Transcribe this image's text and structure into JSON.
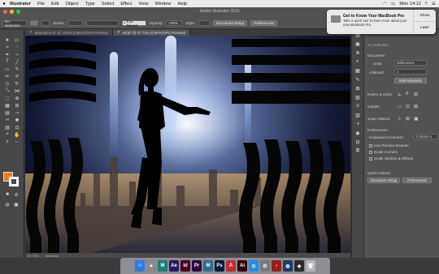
{
  "menubar": {
    "apple": "",
    "app_name": "Illustrator",
    "items": [
      "File",
      "Edit",
      "Object",
      "Type",
      "Select",
      "Effect",
      "View",
      "Window",
      "Help"
    ],
    "clock": "Mon 14:12"
  },
  "window": {
    "title": "Adobe Illustrator 2019"
  },
  "control_bar": {
    "selection": "No Selection",
    "stroke_label": "Stroke:",
    "brush": "5 pt. Round",
    "opacity_label": "Opacity:",
    "opacity_value": "100%",
    "style_label": "Style:",
    "document_setup": "Document Setup",
    "preferences": "Preferences"
  },
  "tabs": [
    {
      "label": "Mountains.ai* @ 16.5% (CMYK/GPU Preview)",
      "active": false
    },
    {
      "label": "SCai* @ 47.73% (CMYK/GPU Preview)",
      "active": true
    }
  ],
  "status": {
    "zoom": "47.73%",
    "tool": "Selection"
  },
  "notification": {
    "title": "Get to Know Your MacBook Pro",
    "body": "Take a quick tour to learn more about your new MacBook Pro.",
    "show": "Show",
    "later": "Later"
  },
  "panel": {
    "tabs": [
      "Properties",
      "Libraries"
    ],
    "no_selection": "No Selection",
    "document": "Document",
    "units_label": "Units",
    "units_value": "Millimeters",
    "artboard_label": "Artboard",
    "artboard_value": "1",
    "edit_artboards": "Edit Artboards",
    "rulers_grids": "Rulers & Grids",
    "guides": "Guides",
    "snap_options": "Snap Options",
    "preferences": "Preferences",
    "keyboard_increment_label": "Keyboard Increment:",
    "keyboard_increment_value": "0.3528 m",
    "use_preview_bounds": "Use Preview Bounds",
    "scale_corners": "Scale Corners",
    "scale_strokes": "Scale Strokes & Effects",
    "quick_actions": "Quick Actions",
    "document_setup": "Document Setup",
    "preferences_btn": "Preferences"
  },
  "colors": {
    "fill": "#e37b2c",
    "accent": "#1473e6",
    "ui_dark": "#535353"
  },
  "dock": [
    {
      "name": "finder",
      "glyph": "☺",
      "color": "#2c7be5"
    },
    {
      "name": "launchpad",
      "glyph": "✦",
      "color": "#8a8a8a"
    },
    {
      "name": "illustrator-m",
      "glyph": "M",
      "color": "#1b7f7a"
    },
    {
      "name": "after-effects",
      "glyph": "Ae",
      "color": "#2b1b5a"
    },
    {
      "name": "indesign",
      "glyph": "Id",
      "color": "#49021f"
    },
    {
      "name": "premiere",
      "glyph": "Pr",
      "color": "#2a0a3e"
    },
    {
      "name": "app-m2",
      "glyph": "M",
      "color": "#2e6d8e"
    },
    {
      "name": "photoshop",
      "glyph": "Ps",
      "color": "#001e36"
    },
    {
      "name": "autocad",
      "glyph": "A",
      "color": "#c32e2e"
    },
    {
      "name": "illustrator",
      "glyph": "Ai",
      "color": "#330000"
    },
    {
      "name": "safari",
      "glyph": "⊙",
      "color": "#1f8fe5"
    },
    {
      "name": "system-prefs",
      "glyph": "⚙",
      "color": "#7a7a7a"
    },
    {
      "name": "app-red",
      "glyph": "♪",
      "color": "#9b1c1c"
    },
    {
      "name": "app-blue",
      "glyph": "◍",
      "color": "#203a6b"
    },
    {
      "name": "app-dark",
      "glyph": "◆",
      "color": "#2b2b2b"
    },
    {
      "name": "trash",
      "glyph": "🗑",
      "color": "#b5b5b5"
    }
  ]
}
